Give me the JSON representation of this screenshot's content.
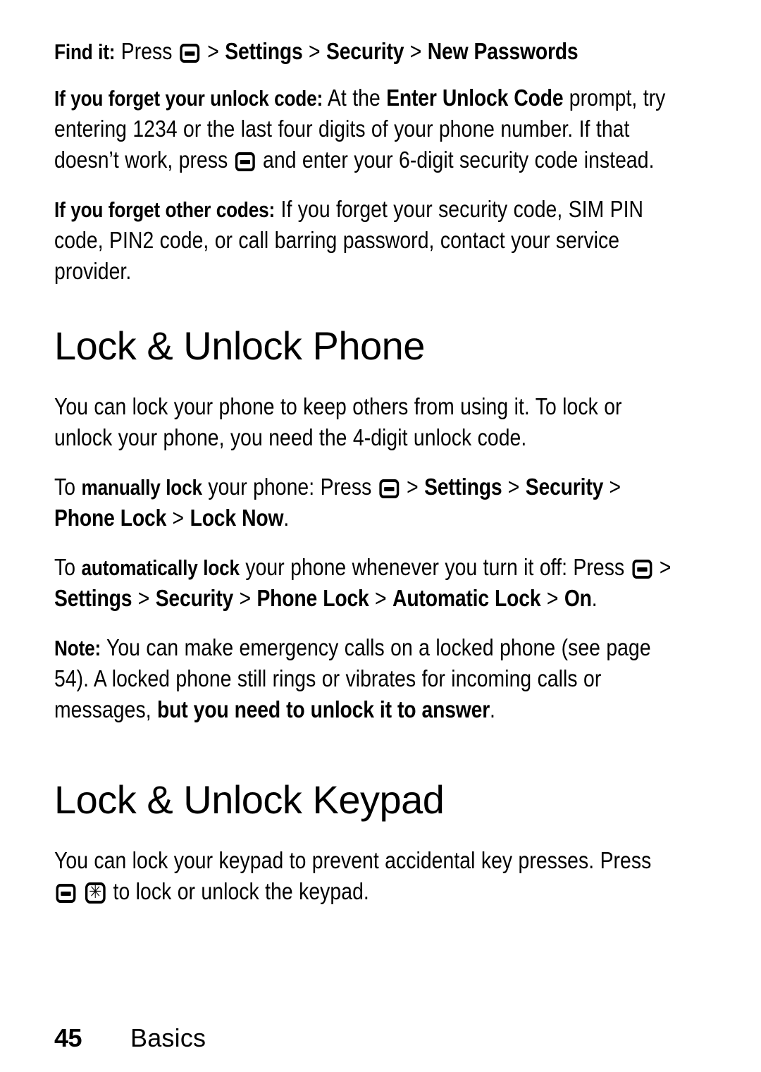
{
  "page": {
    "number": "45",
    "chapter": "Basics"
  },
  "icons": {
    "menu_key": "menu-key-icon",
    "star_key": "star-key-icon",
    "star_glyph": "✳"
  },
  "find_it": {
    "label": "Find it:",
    "press": "Press",
    "sep": ">",
    "path": [
      "Settings",
      "Security",
      "New Passwords"
    ]
  },
  "paragraphs": {
    "forget_unlock": {
      "lead": "If you forget your unlock code:",
      "text_a": "At the",
      "prompt": "Enter Unlock Code",
      "text_b": "prompt, try entering 1234 or the last four digits of your phone number. If that doesn’t work, press",
      "text_c": "and enter your 6-digit security code instead."
    },
    "forget_other": {
      "lead": "If you forget other codes:",
      "text": "If you forget your security code, SIM PIN code, PIN2 code, or call barring password, contact your service provider."
    }
  },
  "section_phone": {
    "heading": "Lock & Unlock Phone",
    "intro": "You can lock your phone to keep others from using it. To lock or unlock your phone, you need the 4-digit unlock code.",
    "manual": {
      "text_a": "To",
      "lead": "manually lock",
      "text_b": "your phone: Press",
      "sep": ">",
      "path": [
        "Settings",
        "Security",
        "Phone Lock",
        "Lock Now"
      ],
      "period": "."
    },
    "automatic": {
      "text_a": "To",
      "lead": "automatically lock",
      "text_b": "your phone whenever you turn it off: Press",
      "sep": ">",
      "path": [
        "Settings",
        "Security",
        "Phone Lock",
        "Automatic Lock",
        "On"
      ],
      "period": "."
    },
    "note": {
      "lead": "Note:",
      "text_a": "You can make emergency calls on a locked phone (see page 54). A locked phone still rings or vibrates for incoming calls or messages,",
      "emphasis": "but you need to unlock it to answer",
      "text_b": "."
    }
  },
  "section_keypad": {
    "heading": "Lock & Unlock Keypad",
    "intro_a": "You can lock your keypad to prevent accidental key presses. Press",
    "intro_b": "to lock or unlock the keypad."
  }
}
